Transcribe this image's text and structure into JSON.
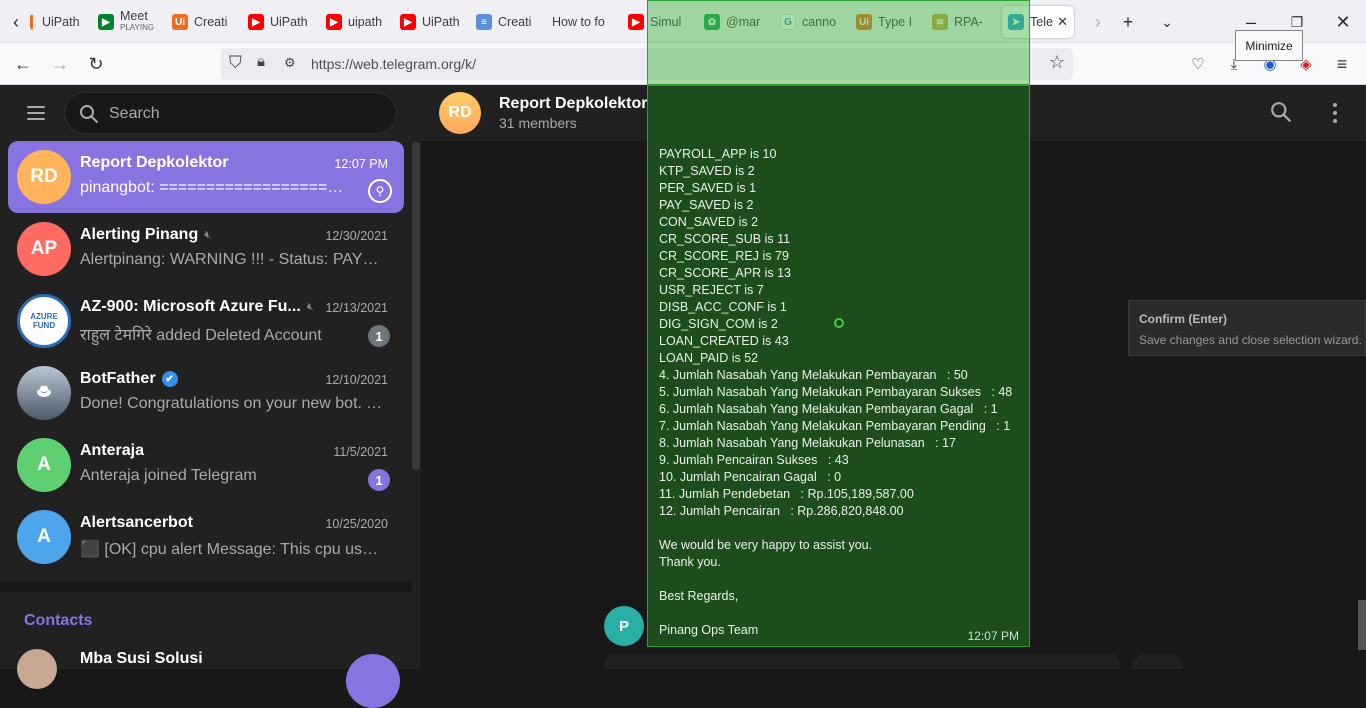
{
  "browser": {
    "tabs": [
      {
        "label": "UiPath",
        "fav_color": "#ffffff",
        "fav_text": "",
        "fav_fg": "#f26a21"
      },
      {
        "label": "Meet",
        "sublabel": "PLAYING",
        "fav_color": "#00832d",
        "fav_text": "▶"
      },
      {
        "label": "Creati",
        "fav_color": "#f26a21",
        "fav_text": "Ui"
      },
      {
        "label": "UiPath",
        "fav_color": "#ff0000",
        "fav_text": "▶"
      },
      {
        "label": "uipath",
        "fav_color": "#ff0000",
        "fav_text": "▶"
      },
      {
        "label": "UiPath",
        "fav_color": "#ff0000",
        "fav_text": "▶"
      },
      {
        "label": "Creati",
        "fav_color": "#5a8fd8",
        "fav_text": "≡"
      },
      {
        "label": "How to fo",
        "fav_color": "",
        "fav_text": ""
      },
      {
        "label": "Simul",
        "fav_color": "#ff0000",
        "fav_text": "▶"
      },
      {
        "label": "@mar",
        "fav_color": "#1a9e5c",
        "fav_text": "✿"
      },
      {
        "label": "canno",
        "fav_color": "#ffffff",
        "fav_text": "G"
      },
      {
        "label": "Type I",
        "fav_color": "#f26a21",
        "fav_text": "Ui"
      },
      {
        "label": "RPA-",
        "fav_color": "#c7a14a",
        "fav_text": "≋"
      },
      {
        "label": "Tele",
        "fav_color": "#2aa3df",
        "fav_text": "➤",
        "active": true
      }
    ],
    "url": "https://web.telegram.org/k/",
    "tooltip": "Minimize"
  },
  "sidebar": {
    "search_placeholder": "Search",
    "chats": [
      {
        "initials": "RD",
        "name": "Report Depkolektor",
        "time": "12:07 PM",
        "preview": "pinangbot: =====================================",
        "selected": true,
        "pinned": true,
        "avatar_color": "#ffb35c"
      },
      {
        "initials": "AP",
        "name": "Alerting Pinang",
        "time": "12/30/2021",
        "preview": "Alertpinang: WARNING !!! - Status: PAYROLL_APP",
        "muted": true,
        "avatar_color": "#ff6a63"
      },
      {
        "initials": "",
        "name": "AZ-900: Microsoft Azure Fu...",
        "time": "12/13/2021",
        "preview": "राहुल टेमगिरे added Deleted Account",
        "muted": true,
        "badge": "1",
        "avatar_color": "#ffffff"
      },
      {
        "initials": "",
        "name": "BotFather",
        "time": "12/10/2021",
        "preview": "Done! Congratulations on your new bot. You will",
        "verified": true,
        "avatar_color": "#6a7a8a"
      },
      {
        "initials": "A",
        "name": "Anteraja",
        "time": "11/5/2021",
        "preview": "Anteraja joined Telegram",
        "badge": "1",
        "badge_color": "purple",
        "avatar_color": "#5fd071"
      },
      {
        "initials": "A",
        "name": "Alertsancerbot",
        "time": "10/25/2020",
        "preview": "⬛ [OK] cpu alert Message: This cpu usage is normal",
        "avatar_color": "#4fa5ec"
      }
    ],
    "contacts_heading": "Contacts",
    "contact_first": "Mba Susi Solusi"
  },
  "chat": {
    "title": "Report Depkolektor",
    "subtitle": "31 members",
    "sender_initial": "P",
    "message_lines": [
      "PAYROLL_APP is 10",
      "KTP_SAVED is 2",
      "PER_SAVED is 1",
      "PAY_SAVED is 2",
      "CON_SAVED is 2",
      "CR_SCORE_SUB is 11",
      "CR_SCORE_REJ is 79",
      "CR_SCORE_APR is 13",
      "USR_REJECT is 7",
      "DISB_ACC_CONF is 1",
      "DIG_SIGN_COM is 2",
      "LOAN_CREATED is 43",
      "LOAN_PAID is 52",
      "4. Jumlah Nasabah Yang Melakukan Pembayaran   : 50",
      "5. Jumlah Nasabah Yang Melakukan Pembayaran Sukses   : 48",
      "6. Jumlah Nasabah Yang Melakukan Pembayaran Gagal   : 1",
      "7. Jumlah Nasabah Yang Melakukan Pembayaran Pending   : 1",
      "8. Jumlah Nasabah Yang Melakukan Pelunasan   : 17",
      "9. Jumlah Pencairan Sukses   : 43",
      "10. Jumlah Pencairan Gagal   : 0",
      "11. Jumlah Pendebetan   : Rp.105,189,587.00",
      "12. Jumlah Pencairan   : Rp.286,820,848.00",
      "",
      "We would be very happy to assist you.",
      "Thank you.",
      "",
      "Best Regards,",
      "",
      "Pinang Ops Team"
    ],
    "message_time": "12:07 PM"
  },
  "wizard_tooltip": {
    "title": "Confirm (Enter)",
    "description": "Save changes and close selection wizard."
  }
}
